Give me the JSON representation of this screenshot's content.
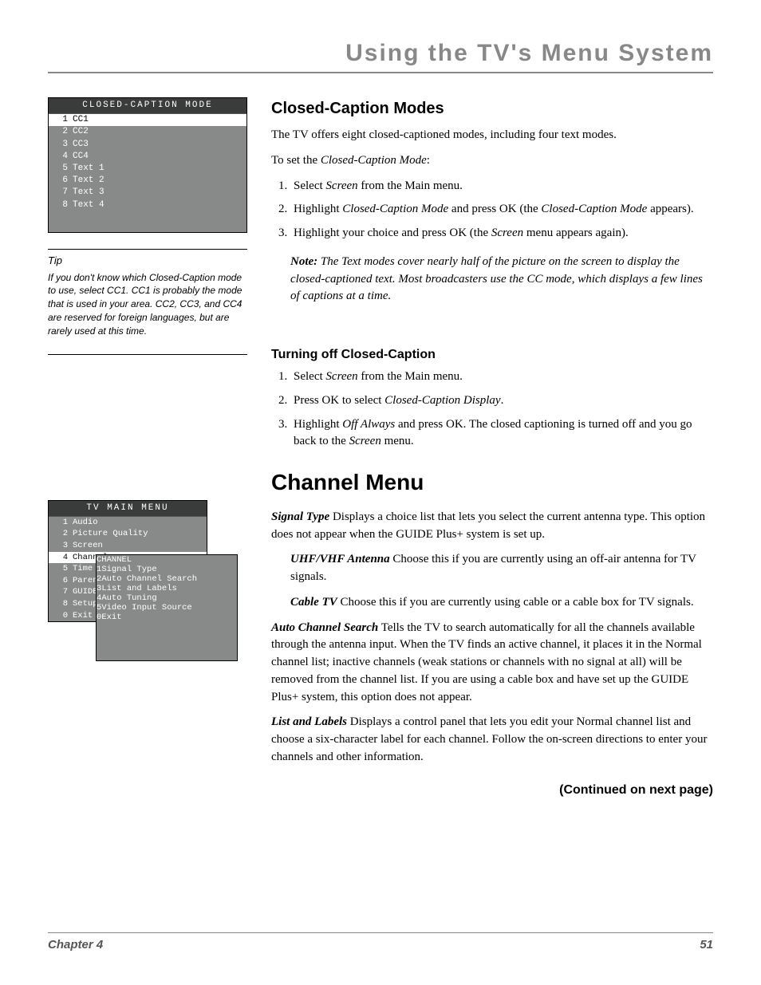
{
  "header": "Using the TV's Menu System",
  "ccMenu": {
    "title": "CLOSED-CAPTION MODE",
    "items": [
      {
        "n": "1",
        "label": "CC1",
        "sel": true
      },
      {
        "n": "2",
        "label": "CC2"
      },
      {
        "n": "3",
        "label": "CC3"
      },
      {
        "n": "4",
        "label": "CC4"
      },
      {
        "n": "5",
        "label": "Text 1"
      },
      {
        "n": "6",
        "label": "Text 2"
      },
      {
        "n": "7",
        "label": "Text 3"
      },
      {
        "n": "8",
        "label": "Text 4"
      }
    ]
  },
  "tip": {
    "label": "Tip",
    "body": "If you don't know which Closed-Caption mode to use, select CC1. CC1 is probably the mode that is used in your area. CC2, CC3, and CC4 are reserved for foreign languages, but are rarely used at this time."
  },
  "mainMenu": {
    "title": "TV MAIN MENU",
    "items": [
      {
        "n": "1",
        "label": "Audio"
      },
      {
        "n": "2",
        "label": "Picture Quality"
      },
      {
        "n": "3",
        "label": "Screen"
      },
      {
        "n": "4",
        "label": "Channel",
        "sel": true
      },
      {
        "n": "5",
        "label": "Time"
      },
      {
        "n": "6",
        "label": "Paren"
      },
      {
        "n": "7",
        "label": "GUIDE"
      },
      {
        "n": "8",
        "label": "Setup"
      },
      {
        "n": "0",
        "label": "Exit"
      }
    ]
  },
  "chMenu": {
    "title": "CHANNEL",
    "items": [
      {
        "n": "1",
        "label": "Signal Type"
      },
      {
        "n": "2",
        "label": "Auto Channel Search"
      },
      {
        "n": "3",
        "label": "List and Labels"
      },
      {
        "n": "4",
        "label": "Auto Tuning",
        "sel": true
      },
      {
        "n": "5",
        "label": "Video Input Source"
      },
      {
        "n": "0",
        "label": "Exit"
      }
    ]
  },
  "s1": {
    "h": "Closed-Caption Modes",
    "p1": "The TV offers eight closed-captioned modes, including four text modes.",
    "p2a": "To set the ",
    "p2b": "Closed-Caption Mode",
    "p2c": ":",
    "li1a": "Select ",
    "li1b": "Screen",
    "li1c": " from the Main menu.",
    "li2a": "Highlight ",
    "li2b": "Closed-Caption Mode",
    "li2c": " and press OK  (the ",
    "li2d": "Closed-Caption Mode",
    "li2e": " appears).",
    "li3a": "Highlight your choice and press OK (the ",
    "li3b": "Screen",
    "li3c": " menu appears again).",
    "noteLabel": "Note:",
    "note": "  The Text modes cover nearly half of the picture on the screen to display the closed-captioned text. Most broadcasters use the CC mode, which displays a few lines of captions at a time."
  },
  "s2": {
    "h": "Turning off Closed-Caption",
    "li1a": "Select ",
    "li1b": "Screen",
    "li1c": " from the Main menu.",
    "li2a": "Press OK to select ",
    "li2b": "Closed-Caption Display",
    "li2c": ".",
    "li3a": "Highlight ",
    "li3b": "Off Always",
    "li3c": " and press OK. The closed captioning is turned off and you go back to the ",
    "li3d": "Screen",
    "li3e": " menu."
  },
  "s3": {
    "h": "Channel Menu",
    "p1t": "Signal Type",
    "p1": "   Displays a choice list that lets you select the current antenna type. This option does not appear when the GUIDE Plus+ system is set up.",
    "p2t": "UHF/VHF Antenna",
    "p2": "   Choose this if you are currently using an off-air antenna for TV signals.",
    "p3t": "Cable TV",
    "p3": "   Choose this if you are currently using cable or a cable box for TV signals.",
    "p4t": "Auto Channel Search",
    "p4": "   Tells the TV to search automatically for all the channels available through the antenna input. When the TV finds an active channel, it places it in the Normal channel list; inactive channels (weak stations or channels with no signal at all) will be removed from the channel list. If you are using a cable box and have set up the GUIDE Plus+ system, this option does not appear.",
    "p5t": "List and Labels",
    "p5": "   Displays a control panel that lets you edit your Normal channel list and choose a six-character label for each channel. Follow the on-screen directions to enter your channels and other information."
  },
  "continued": "(Continued on next page)",
  "footer": {
    "left": "Chapter 4",
    "right": "51"
  }
}
